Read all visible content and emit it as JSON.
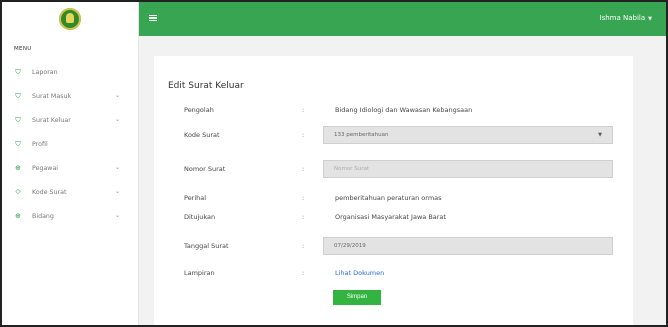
{
  "sidebar": {
    "menu_title": "MENU",
    "items": [
      {
        "label": "Laporan",
        "icon": "tag-icon",
        "has_submenu": false
      },
      {
        "label": "Surat Masuk",
        "icon": "tag-icon",
        "has_submenu": true
      },
      {
        "label": "Surat Keluar",
        "icon": "tag-icon",
        "has_submenu": true
      },
      {
        "label": "Profil",
        "icon": "tag-icon",
        "has_submenu": false
      },
      {
        "label": "Pegawai",
        "icon": "globe-icon",
        "has_submenu": true
      },
      {
        "label": "Kode Surat",
        "icon": "layers-icon",
        "has_submenu": true
      },
      {
        "label": "Bidang",
        "icon": "globe-icon",
        "has_submenu": true
      }
    ]
  },
  "topbar": {
    "user_name": "Ishma Nabila",
    "accent": "#37a552"
  },
  "form": {
    "title": "Edit Surat Keluar",
    "colon": ":",
    "pengolah": {
      "label": "Pengolah",
      "value": "Bidang Idiologi dan Wawasan Kebangsaan"
    },
    "kode_surat": {
      "label": "Kode Surat",
      "value": "133 pemberitahuan"
    },
    "nomor_surat": {
      "label": "Nomor Surat",
      "placeholder": "Nomor Surat"
    },
    "perihal": {
      "label": "Perihal",
      "value": "pemberitahuan peraturan ormas"
    },
    "ditujukan": {
      "label": "Ditujukan",
      "value": "Organisasi Masyarakat Jawa Barat"
    },
    "tanggal_surat": {
      "label": "Tanggal Surat",
      "value": "07/29/2019"
    },
    "lampiran": {
      "label": "Lampiran",
      "link_text": "Lihat Dokumen"
    },
    "submit_label": "Simpan"
  }
}
